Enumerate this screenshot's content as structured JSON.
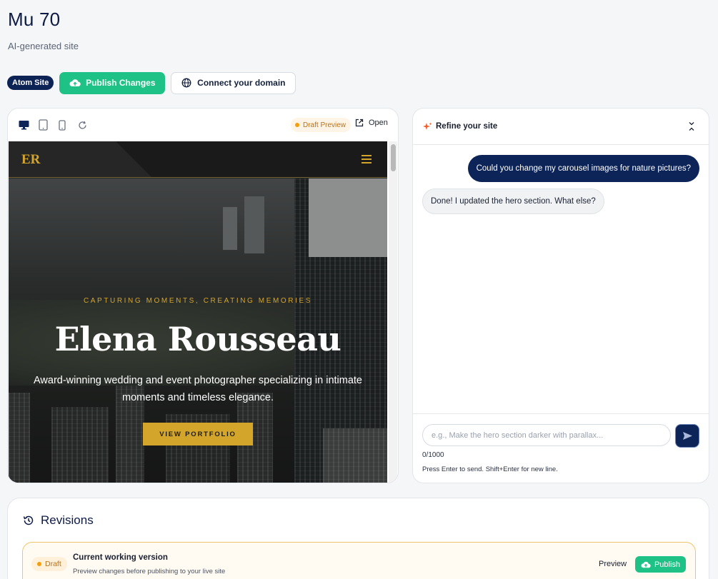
{
  "page": {
    "title": "Mu 70",
    "subtitle": "AI-generated site"
  },
  "actions": {
    "badge": "Atom Site",
    "publish_label": "Publish Changes",
    "domain_label": "Connect your domain"
  },
  "preview": {
    "draft_label": "Draft Preview",
    "open_label": "Open",
    "site": {
      "logo": "ER",
      "tagline": "CAPTURING MOMENTS, CREATING MEMORIES",
      "name": "Elena Rousseau",
      "description": "Award-winning wedding and event photographer specializing in intimate moments and timeless elegance.",
      "cta": "VIEW PORTFOLIO"
    }
  },
  "chat": {
    "title": "Refine your site",
    "messages": [
      {
        "role": "user",
        "text": "Could you change my carousel images for nature pictures?"
      },
      {
        "role": "assistant",
        "text": "Done! I updated the hero section. What else?"
      }
    ],
    "input_placeholder": "e.g., Make the hero section darker with parallax...",
    "char_count": "0/1000",
    "hint": "Press Enter to send. Shift+Enter for new line."
  },
  "revisions": {
    "title": "Revisions",
    "current": {
      "badge": "Draft",
      "name": "Current working version",
      "description": "Preview changes before publishing to your live site",
      "preview_label": "Preview",
      "publish_label": "Publish"
    }
  },
  "colors": {
    "accent_green": "#1fc286",
    "navy": "#0d2458",
    "gold": "#d4a52b",
    "draft_orange": "#f59e0b"
  }
}
